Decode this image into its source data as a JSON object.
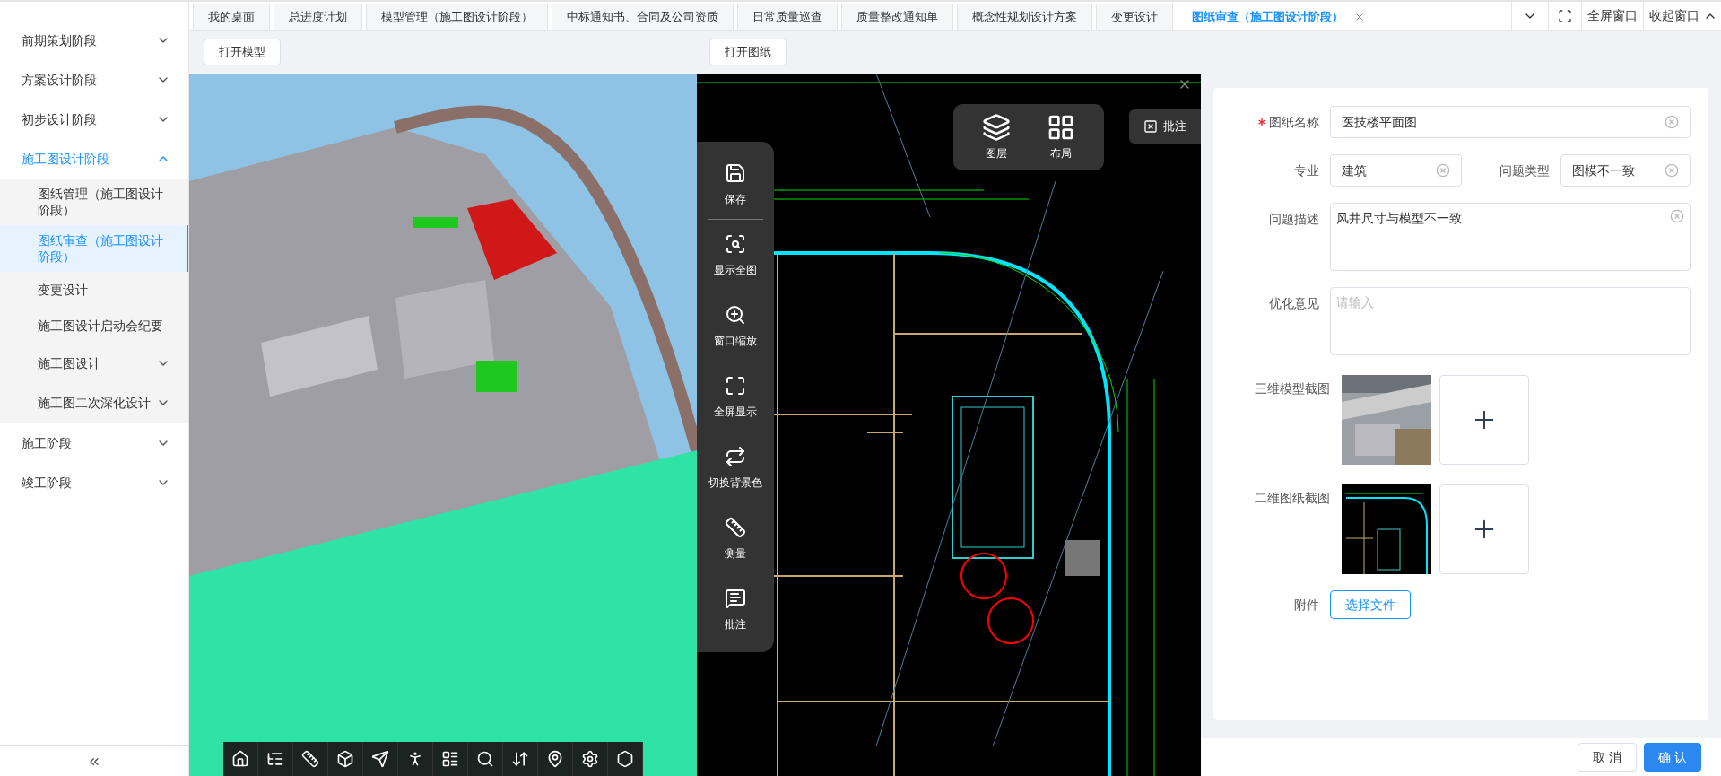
{
  "tabs": [
    {
      "label": "我的桌面",
      "selected": false
    },
    {
      "label": "总进度计划",
      "selected": false
    },
    {
      "label": "模型管理（施工图设计阶段）",
      "selected": false
    },
    {
      "label": "中标通知书、合同及公司资质",
      "selected": false
    },
    {
      "label": "日常质量巡查",
      "selected": false
    },
    {
      "label": "质量整改通知单",
      "selected": false
    },
    {
      "label": "概念性规划设计方案",
      "selected": false
    },
    {
      "label": "变更设计",
      "selected": false
    },
    {
      "label": "图纸审查（施工图设计阶段）",
      "selected": true
    }
  ],
  "window_actions": {
    "fullscreen": "全屏窗口",
    "collapse": "收起窗口"
  },
  "sidebar": {
    "items": [
      {
        "label": "前期策划阶段",
        "kind": "group",
        "expanded": false,
        "selected": false
      },
      {
        "label": "方案设计阶段",
        "kind": "group",
        "expanded": false,
        "selected": false
      },
      {
        "label": "初步设计阶段",
        "kind": "group",
        "expanded": false,
        "selected": false
      },
      {
        "label": "施工图设计阶段",
        "kind": "group",
        "expanded": true,
        "selected": true,
        "children": [
          {
            "label": "图纸管理（施工图设计阶段）",
            "kind": "link",
            "selected": false
          },
          {
            "label": "图纸审查（施工图设计阶段）",
            "kind": "link",
            "selected": true
          },
          {
            "label": "变更设计",
            "kind": "link",
            "selected": false
          },
          {
            "label": "施工图设计启动会纪要",
            "kind": "link",
            "selected": false
          },
          {
            "label": "施工图设计",
            "kind": "group",
            "expanded": false,
            "selected": false
          },
          {
            "label": "施工图二次深化设计",
            "kind": "group",
            "expanded": false,
            "selected": false
          }
        ]
      },
      {
        "label": "施工阶段",
        "kind": "group",
        "expanded": false,
        "selected": false
      },
      {
        "label": "竣工阶段",
        "kind": "group",
        "expanded": false,
        "selected": false
      }
    ]
  },
  "model_viewer": {
    "open_button": "打开模型"
  },
  "drawing_viewer": {
    "open_button": "打开图纸",
    "tools": [
      {
        "label": "保存",
        "divider": true
      },
      {
        "label": "显示全图",
        "divider": false
      },
      {
        "label": "窗口缩放",
        "divider": false
      },
      {
        "label": "全屏显示",
        "divider": true
      },
      {
        "label": "切换背景色",
        "divider": false
      },
      {
        "label": "测量",
        "divider": false
      },
      {
        "label": "批注",
        "divider": false
      }
    ],
    "top_tools": [
      {
        "label": "图层"
      },
      {
        "label": "布局"
      }
    ],
    "annotate_button": "批注"
  },
  "form": {
    "fields": [
      {
        "label": "图纸名称",
        "required": true,
        "value": "医技楼平面图"
      },
      {
        "label": "专业",
        "required": false,
        "value": "建筑"
      },
      {
        "label": "问题类型",
        "required": false,
        "value": "图模不一致"
      },
      {
        "label": "问题描述",
        "required": false,
        "value": "风井尺寸与模型不一致"
      },
      {
        "label": "优化意见",
        "required": false,
        "placeholder": "请输入"
      }
    ],
    "screenshots": [
      {
        "label": "三维模型截图",
        "kind": "model"
      },
      {
        "label": "二维图纸截图",
        "kind": "drawing"
      }
    ],
    "attachment": {
      "label": "附件",
      "button": "选择文件"
    }
  },
  "footer": {
    "cancel": "取 消",
    "confirm": "确 认"
  }
}
